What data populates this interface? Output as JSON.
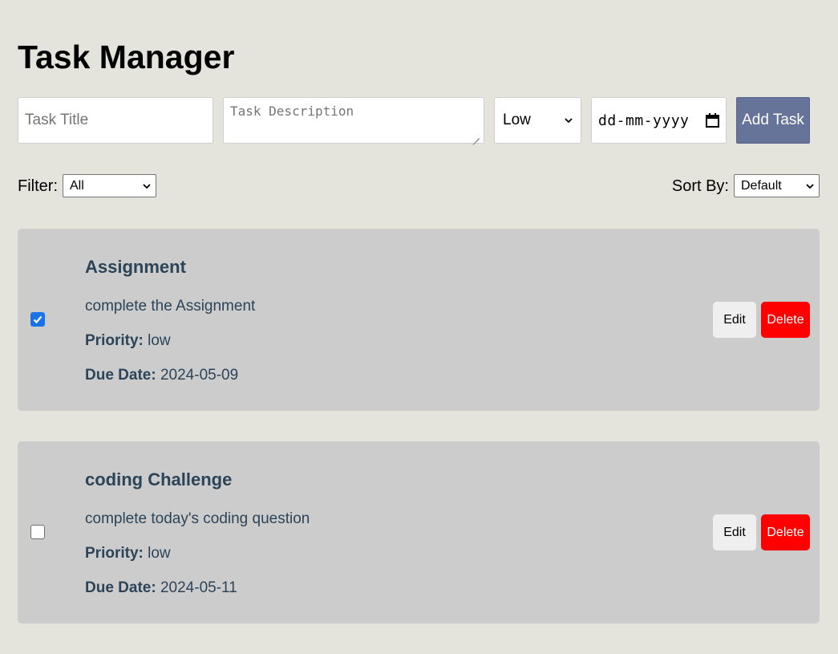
{
  "header": {
    "title": "Task Manager"
  },
  "form": {
    "title_placeholder": "Task Title",
    "title_value": "",
    "description_placeholder": "Task Description",
    "description_value": "",
    "priority_selected": "Low",
    "date_placeholder": "dd-mm-yyyy",
    "add_label": "Add Task",
    "add_color": "#67749a"
  },
  "filter": {
    "label": "Filter:",
    "selected": "All"
  },
  "sort": {
    "label": "Sort By:",
    "selected": "Default"
  },
  "tasks": [
    {
      "completed": true,
      "title": "Assignment",
      "description": "complete the Assignment",
      "priority_label": "Priority:",
      "priority": "low",
      "due_label": "Due Date:",
      "due_date": "2024-05-09",
      "edit_label": "Edit",
      "delete_label": "Delete"
    },
    {
      "completed": false,
      "title": "coding Challenge",
      "description": "complete today's coding question",
      "priority_label": "Priority:",
      "priority": "low",
      "due_label": "Due Date:",
      "due_date": "2024-05-11",
      "edit_label": "Edit",
      "delete_label": "Delete"
    }
  ],
  "colors": {
    "background": "#e4e4dc",
    "card": "#cccccc",
    "task_text": "#2c4457",
    "delete": "#ff0000",
    "checkbox_checked": "#1a73e8"
  },
  "icons": {
    "select_arrow": "chevron-down-icon",
    "date_picker": "calendar-icon",
    "checkbox_mark": "check-icon"
  }
}
